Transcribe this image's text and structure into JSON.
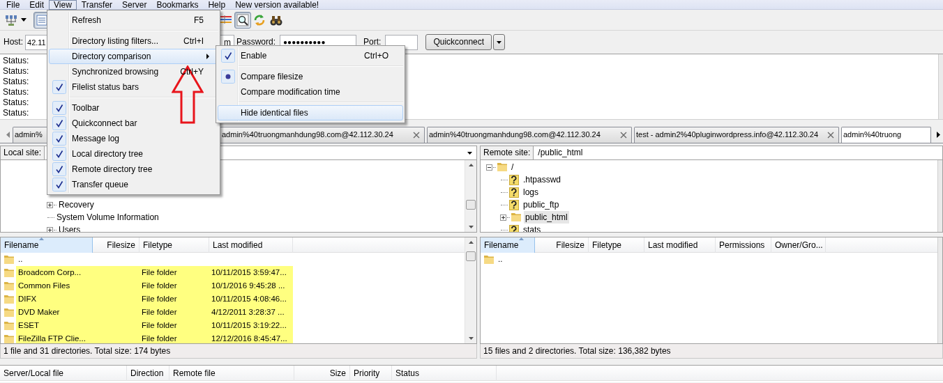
{
  "menubar": [
    {
      "label": "File",
      "selected": false
    },
    {
      "label": "Edit",
      "selected": false
    },
    {
      "label": "View",
      "selected": true
    },
    {
      "label": "Transfer",
      "selected": false
    },
    {
      "label": "Server",
      "selected": false
    },
    {
      "label": "Bookmarks",
      "selected": false
    },
    {
      "label": "Help",
      "selected": false
    },
    {
      "label": "New version available!",
      "selected": false
    }
  ],
  "toolbar": [
    {
      "kind": "site-manager",
      "pressed": false
    },
    {
      "kind": "dropdown",
      "pressed": false
    },
    {
      "kind": "toggle",
      "pressed": true
    },
    {
      "kind": "filter",
      "pressed": false
    },
    {
      "kind": "compare",
      "pressed": true
    },
    {
      "kind": "refresh",
      "pressed": false
    },
    {
      "kind": "find",
      "pressed": false
    }
  ],
  "quickconnect": {
    "host_label": "Host:",
    "host": "42.11",
    "username": "m",
    "password_label": "Password:",
    "password": "●●●●●●●●●●",
    "port_label": "Port:",
    "button": "Quickconnect"
  },
  "message_log": [
    "Status:",
    "Status:",
    "Status:",
    "Status:",
    "Status:",
    "Status:"
  ],
  "tabs": [
    {
      "label": "admin%",
      "closable": false,
      "selected": false
    },
    {
      "label": "admin%40truongmanhdung98.com@42.112.30.24",
      "closable": true,
      "selected": false
    },
    {
      "label": "admin%40truongmanhdung98.com@42.112.30.24",
      "closable": true,
      "selected": false
    },
    {
      "label": "test - admin2%40pluginwordpress.info@42.112.30.24",
      "closable": true,
      "selected": false
    },
    {
      "label": "admin%40truong",
      "closable": false,
      "selected": true
    }
  ],
  "local": {
    "site_label": "Local site:",
    "tree": [
      {
        "label": "Recovery",
        "expanded": false,
        "selected": false
      },
      {
        "label": "System Volume Information",
        "selected": false
      },
      {
        "label": "Users",
        "expanded": false,
        "selected": false
      }
    ],
    "columns": [
      {
        "label": "Filename",
        "kind": "text",
        "sorted": true
      },
      {
        "label": "Filesize",
        "kind": "size",
        "sorted": false
      },
      {
        "label": "Filetype",
        "kind": "text",
        "sorted": false
      },
      {
        "label": "Last modified",
        "kind": "text",
        "sorted": false
      }
    ],
    "rows": [
      {
        "name": "..",
        "highlighted": false
      },
      {
        "name": "Broadcom Corp...",
        "type": "File folder",
        "modified": "10/11/2015 3:59:47...",
        "highlighted": true
      },
      {
        "name": "Common Files",
        "type": "File folder",
        "modified": "10/1/2016 9:45:28 ...",
        "highlighted": true
      },
      {
        "name": "DIFX",
        "type": "File folder",
        "modified": "10/11/2015 4:08:46...",
        "highlighted": true
      },
      {
        "name": "DVD Maker",
        "type": "File folder",
        "modified": "4/12/2011 3:28:37 ...",
        "highlighted": true
      },
      {
        "name": "ESET",
        "type": "File folder",
        "modified": "10/11/2015 3:19:22...",
        "highlighted": true
      },
      {
        "name": "FileZilla FTP Clie...",
        "type": "File folder",
        "modified": "12/12/2016 8:45:47...",
        "highlighted": true
      }
    ],
    "status": "1 file and 31 directories. Total size: 174 bytes"
  },
  "remote": {
    "site_label": "Remote site:",
    "path": "/public_html",
    "tree": [
      {
        "label": "/",
        "kind": "folder",
        "expanded": true,
        "selected": false,
        "children": [
          {
            "label": ".htpasswd",
            "kind": "file",
            "selected": false
          },
          {
            "label": "logs",
            "kind": "file",
            "selected": false
          },
          {
            "label": "public_ftp",
            "kind": "file",
            "selected": false
          },
          {
            "label": "public_html",
            "kind": "folder",
            "expanded": false,
            "selected": true
          },
          {
            "label": "stats",
            "kind": "file",
            "selected": false
          }
        ]
      }
    ],
    "columns": [
      {
        "label": "Filename",
        "kind": "text",
        "sorted": true
      },
      {
        "label": "Filesize",
        "kind": "size",
        "sorted": false
      },
      {
        "label": "Filetype",
        "kind": "text",
        "sorted": false
      },
      {
        "label": "Last modified",
        "kind": "text",
        "sorted": false
      },
      {
        "label": "Permissions",
        "kind": "text",
        "sorted": false
      },
      {
        "label": "Owner/Gro...",
        "kind": "text",
        "sorted": false
      }
    ],
    "rows": [
      {
        "name": "..",
        "highlighted": false
      }
    ],
    "status": "15 files and 2 directories. Total size: 136,382 bytes"
  },
  "queue": {
    "columns": [
      {
        "label": "Server/Local file",
        "kind": "text"
      },
      {
        "label": "Direction",
        "kind": "text"
      },
      {
        "label": "Remote file",
        "kind": "text"
      },
      {
        "label": "Size",
        "kind": "size"
      },
      {
        "label": "Priority",
        "kind": "text"
      },
      {
        "label": "Status",
        "kind": "text"
      }
    ]
  },
  "view_menu": [
    {
      "kind": "command",
      "label": "Refresh",
      "shortcut": "F5",
      "selected": false
    },
    {
      "kind": "separator"
    },
    {
      "kind": "command",
      "label": "Directory listing filters...",
      "shortcut": "Ctrl+I",
      "selected": false
    },
    {
      "kind": "submenu",
      "label": "Directory comparison",
      "selected": true
    },
    {
      "kind": "check",
      "label": "Synchronized browsing",
      "shortcut": "Ctrl+Y",
      "checked": false,
      "selected": false
    },
    {
      "kind": "check",
      "label": "Filelist status bars",
      "checked": true,
      "selected": false
    },
    {
      "kind": "separator"
    },
    {
      "kind": "check",
      "label": "Toolbar",
      "checked": true,
      "selected": false
    },
    {
      "kind": "check",
      "label": "Quickconnect bar",
      "checked": true,
      "selected": false
    },
    {
      "kind": "check",
      "label": "Message log",
      "checked": true,
      "selected": false
    },
    {
      "kind": "check",
      "label": "Local directory tree",
      "checked": true,
      "selected": false
    },
    {
      "kind": "check",
      "label": "Remote directory tree",
      "checked": true,
      "selected": false
    },
    {
      "kind": "check",
      "label": "Transfer queue",
      "checked": true,
      "selected": false
    }
  ],
  "comparison_menu": [
    {
      "kind": "check",
      "label": "Enable",
      "shortcut": "Ctrl+O",
      "checked": true,
      "selected": false
    },
    {
      "kind": "separator"
    },
    {
      "kind": "radio",
      "label": "Compare filesize",
      "checked": true,
      "selected": false
    },
    {
      "kind": "radio",
      "label": "Compare modification time",
      "checked": false,
      "selected": false
    },
    {
      "kind": "separator"
    },
    {
      "kind": "check",
      "label": "Hide identical files",
      "checked": false,
      "selected": true
    }
  ]
}
